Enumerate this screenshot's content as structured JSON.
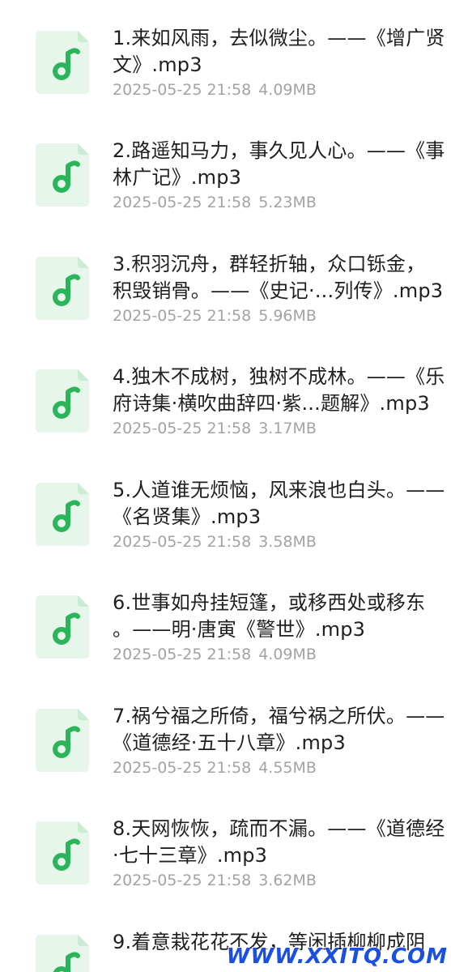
{
  "files": [
    {
      "title_line1": "1.来如风雨，去似微尘。——《增广贤",
      "title_line2": "文》.mp3",
      "date": "2025-05-25 21:58",
      "size": "4.09MB",
      "icon": "music-file-icon"
    },
    {
      "title_line1": "2.路遥知马力，事久见人心。——《事",
      "title_line2": "林广记》.mp3",
      "date": "2025-05-25 21:58",
      "size": "5.23MB",
      "icon": "music-file-icon"
    },
    {
      "title_line1": "3.积羽沉舟，群轻折轴，众口铄金，",
      "title_line2": "积毁销骨。——《史记·...列传》.mp3",
      "date": "2025-05-25 21:58",
      "size": "5.96MB",
      "icon": "music-file-icon"
    },
    {
      "title_line1": "4.独木不成树，独树不成林。——《乐",
      "title_line2": "府诗集·横吹曲辞四·紫...题解》.mp3",
      "date": "2025-05-25 21:58",
      "size": "3.17MB",
      "icon": "music-file-icon"
    },
    {
      "title_line1": "5.人道谁无烦恼，风来浪也白头。——",
      "title_line2": "《名贤集》.mp3",
      "date": "2025-05-25 21:58",
      "size": "3.58MB",
      "icon": "music-file-icon"
    },
    {
      "title_line1": "6.世事如舟挂短篷，或移西处或移东",
      "title_line2": "。——明·唐寅《警世》.mp3",
      "date": "2025-05-25 21:58",
      "size": "4.09MB",
      "icon": "music-file-icon"
    },
    {
      "title_line1": "7.祸兮福之所倚，福兮祸之所伏。——",
      "title_line2": "《道德经·五十八章》.mp3",
      "date": "2025-05-25 21:58",
      "size": "4.55MB",
      "icon": "music-file-icon"
    },
    {
      "title_line1": "8.天网恢恢，疏而不漏。——《道德经",
      "title_line2": "·七十三章》.mp3",
      "date": "2025-05-25 21:58",
      "size": "3.62MB",
      "icon": "music-file-icon"
    },
    {
      "title_line1": "9.着意栽花花不发，等闲插柳柳成阴",
      "title_line2": "",
      "date": "",
      "size": "",
      "icon": "music-file-icon"
    }
  ],
  "watermark": "WWW.XXITQ.COM",
  "colors": {
    "icon_green": "#2bb55a",
    "icon_bg": "#e6f6ea",
    "title_text": "#1f1f1f",
    "meta_text": "#a3a3a3",
    "watermark": "#1a4fe0"
  }
}
